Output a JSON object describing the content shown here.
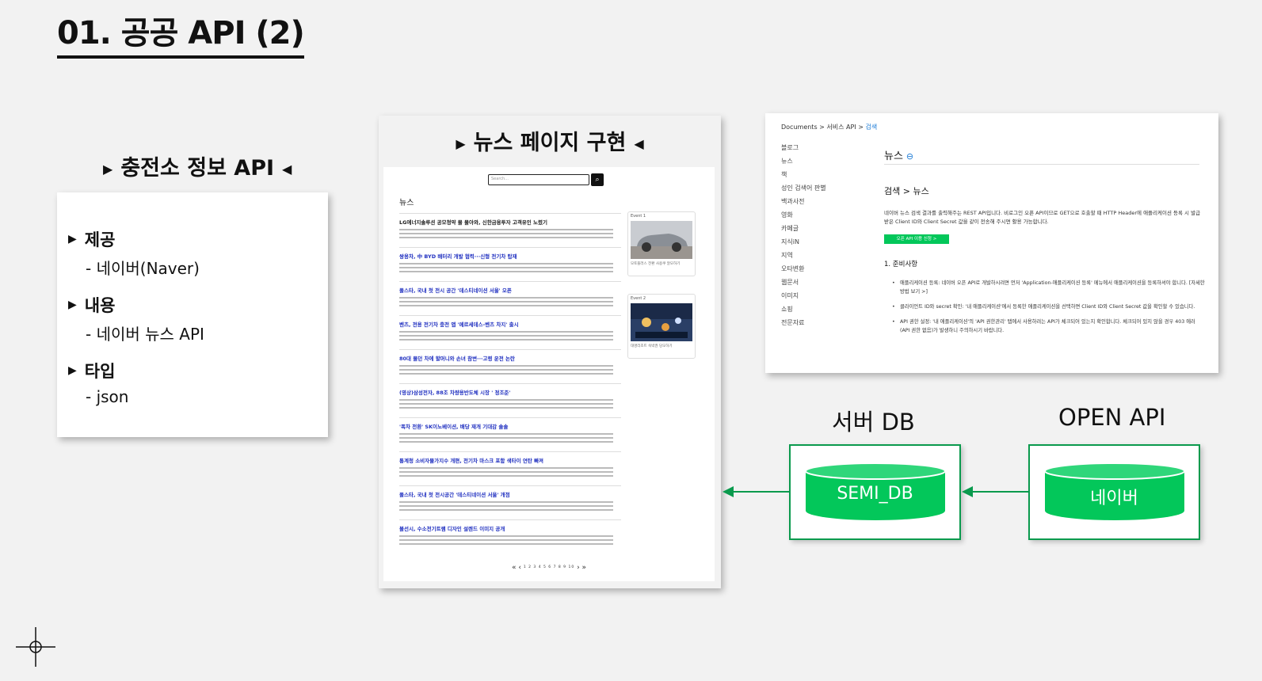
{
  "page": {
    "title": "01. 공공 API (2)"
  },
  "charger_section": {
    "heading": "충전소 정보 API",
    "items": [
      {
        "label": "제공",
        "value": "- 네이버(Naver)"
      },
      {
        "label": "내용",
        "value": "- 네이버 뉴스 API"
      },
      {
        "label": "타입",
        "value": "- json"
      }
    ]
  },
  "news_section": {
    "heading": "뉴스 페이지 구현",
    "search_placeholder": "Search...",
    "list_label": "뉴스",
    "articles": [
      "LG에너지솔루션 공모청약 몰 몰아와, 신한금융투자 고객유인 노렸기",
      "쌍용차, 中 BYD 배터리 개발 협력···신형 전기차 탑재",
      "폴스타, 국내 첫 전시 공간 '데스티네이션 서울' 오픈",
      "벤츠, 전용 전기차 충전 앱 '메르세데스-벤츠 차지' 출시",
      "80대 몰던 차에 할머니와 손녀 참변···고령 운전 논란",
      "(영상)삼성전자, 88조 차량용반도체 시장 ' 정조준'",
      "'폭차 전환' SK이노베이션, 배당 재개 기대감 솔솔",
      "통계청 소비자물가지수 개편, 전기차 마스크 포함 색타이 연탄 빠져",
      "폴스타, 국내 첫 전시공간 '데스티네이션 서울' 개점",
      "볼선시, 수소전기트램 디자인 설렌드 이미지 공개"
    ],
    "events": [
      {
        "label": "Event 1",
        "caption": "모토플러스 전환 사용쿠 알모하기"
      },
      {
        "label": "Event 2",
        "caption": "대명리조트 숙박권 당모하기"
      }
    ],
    "pager": {
      "first": "«",
      "prev": "‹",
      "numbers": "1 2 3 4 5 6 7 8 9 10",
      "next": "›",
      "last": "»"
    }
  },
  "docs_section": {
    "breadcrumb": {
      "root": "Documents",
      "mid": "서비스 API",
      "current": "검색"
    },
    "sidebar": [
      "블로그",
      "뉴스",
      "책",
      "성인 검색어 판별",
      "백과사전",
      "영화",
      "카페글",
      "지식iN",
      "지역",
      "오타변환",
      "웹문서",
      "이미지",
      "쇼핑",
      "전문자료"
    ],
    "title": "뉴스",
    "subtitle": "검색 > 뉴스",
    "intro": "네이버 뉴스 검색 결과를 출력해주는 REST API입니다. 비로그인 오픈 API이므로 GET으로 호출할 때 HTTP Header에 애플리케이션 등록 시 발급받은 Client ID와 Client Secret 값을 같이 전송해 주시면 활용 가능합니다.",
    "button": "오픈 API 이용 신청 >",
    "prep_heading": "1. 준비사항",
    "prep_items": [
      "애플리케이션 등록: 네이버 오픈 API로 개발하시려면 먼저 'Application-애플리케이션 등록' 메뉴에서 애플리케이션을 등록하셔야 합니다. [자세한 방법 보기 >]",
      "클라이언트 ID와 secret 확인: '내 애플리케이션'에서 등록한 애플리케이션을 선택하면 Client ID와 Client Secret 값을 확인할 수 있습니다.",
      "API 권한 설정: '내 애플리케이션'의 'API 권한관리' 탭에서 사용하려는 API가 체크되어 있는지 확인합니다. 체크되어 있지 않을 경우 403 에러(API 권한 없음)가 발생하니 주의하시기 바랍니다."
    ]
  },
  "architecture": {
    "server_label": "서버 DB",
    "server_db": "SEMI_DB",
    "open_label": "OPEN API",
    "open_db": "네이버",
    "colors": {
      "accent": "#03c75a",
      "border": "#0a9a4d"
    }
  }
}
